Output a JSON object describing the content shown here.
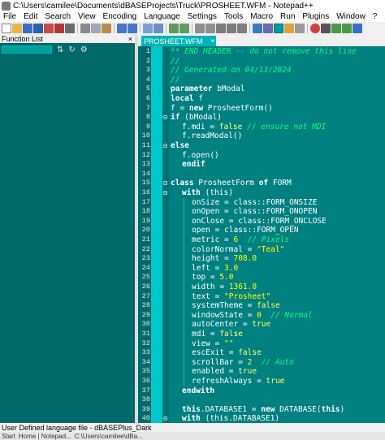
{
  "window": {
    "title": "C:\\Users\\camilee\\Documents\\dBASEProjects\\Truck\\PROSHEET.WFM - Notepad++"
  },
  "menubar": {
    "items": [
      "File",
      "Edit",
      "Search",
      "View",
      "Encoding",
      "Language",
      "Settings",
      "Tools",
      "Macro",
      "Run",
      "Plugins",
      "Window",
      "?"
    ],
    "close_label": "X"
  },
  "function_list": {
    "title": "Function List",
    "close_label": "×",
    "search_value": ""
  },
  "tab": {
    "label": "PROSHEET.WFM",
    "close_label": "×"
  },
  "editor": {
    "lines": [
      {
        "n": "1",
        "fold": "",
        "x": 40,
        "segs": [
          [
            "** END HEADER -- do not remove this line",
            "c-comment"
          ]
        ]
      },
      {
        "n": "2",
        "fold": "",
        "x": 40,
        "segs": [
          [
            "//",
            "c-comment"
          ]
        ]
      },
      {
        "n": "3",
        "fold": "",
        "x": 40,
        "segs": [
          [
            "// Generated on 04/13/2024",
            "c-comment"
          ]
        ]
      },
      {
        "n": "4",
        "fold": "",
        "x": 40,
        "segs": [
          [
            "//",
            "c-comment"
          ]
        ]
      },
      {
        "n": "5",
        "fold": "",
        "x": 40,
        "segs": [
          [
            "parameter",
            "c-kw"
          ],
          [
            " bModal",
            "c-ident"
          ]
        ]
      },
      {
        "n": "6",
        "fold": "",
        "x": 40,
        "segs": [
          [
            "local",
            "c-kw"
          ],
          [
            " f",
            "c-ident"
          ]
        ]
      },
      {
        "n": "7",
        "fold": "",
        "x": 40,
        "segs": [
          [
            "f = ",
            "c-ident"
          ],
          [
            "new",
            "c-kw"
          ],
          [
            " ProsheetForm()",
            "c-ident"
          ]
        ]
      },
      {
        "n": "8",
        "fold": "⊟",
        "x": 40,
        "segs": [
          [
            "if",
            "c-kw"
          ],
          [
            " (bModal)",
            "c-ident"
          ]
        ]
      },
      {
        "n": "9",
        "fold": "",
        "x": 54,
        "segs": [
          [
            "f.mdi = ",
            "c-ident"
          ],
          [
            "false",
            "c-const"
          ],
          [
            " // ensure not MDI",
            "c-comment"
          ]
        ]
      },
      {
        "n": "10",
        "fold": "",
        "x": 54,
        "segs": [
          [
            "f.readModal()",
            "c-ident"
          ]
        ]
      },
      {
        "n": "11",
        "fold": "⊟",
        "x": 40,
        "segs": [
          [
            "else",
            "c-kw"
          ]
        ]
      },
      {
        "n": "12",
        "fold": "",
        "x": 54,
        "segs": [
          [
            "f.open()",
            "c-ident"
          ]
        ]
      },
      {
        "n": "13",
        "fold": "",
        "x": 54,
        "segs": [
          [
            "endif",
            "c-kw"
          ]
        ]
      },
      {
        "n": "14",
        "fold": "",
        "x": 40,
        "segs": []
      },
      {
        "n": "15",
        "fold": "⊟",
        "x": 40,
        "segs": [
          [
            "class",
            "c-kw"
          ],
          [
            " ProsheetForm ",
            "c-ident"
          ],
          [
            "of",
            "c-kw"
          ],
          [
            " FORM",
            "c-ident"
          ]
        ]
      },
      {
        "n": "16",
        "fold": "⊟",
        "x": 54,
        "segs": [
          [
            "with",
            "c-kw"
          ],
          [
            " (this)",
            "c-ident"
          ]
        ]
      },
      {
        "n": "17",
        "fold": "",
        "x": 66,
        "segs": [
          [
            "onSize = class::FORM_ONSIZE",
            "c-ident"
          ]
        ]
      },
      {
        "n": "18",
        "fold": "",
        "x": 66,
        "segs": [
          [
            "onOpen = class::FORM_ONOPEN",
            "c-ident"
          ]
        ]
      },
      {
        "n": "19",
        "fold": "",
        "x": 66,
        "segs": [
          [
            "onClose = class::FORM_ONCLOSE",
            "c-ident"
          ]
        ]
      },
      {
        "n": "20",
        "fold": "",
        "x": 66,
        "segs": [
          [
            "open = class::FORM_OPEN",
            "c-ident"
          ]
        ]
      },
      {
        "n": "21",
        "fold": "",
        "x": 66,
        "segs": [
          [
            "metric = ",
            "c-ident"
          ],
          [
            "6",
            "c-num"
          ],
          [
            "  // Pixels",
            "c-comment"
          ]
        ]
      },
      {
        "n": "22",
        "fold": "",
        "x": 66,
        "segs": [
          [
            "colorNormal = ",
            "c-ident"
          ],
          [
            "\"Teal\"",
            "c-str"
          ]
        ]
      },
      {
        "n": "23",
        "fold": "",
        "x": 66,
        "segs": [
          [
            "height = ",
            "c-ident"
          ],
          [
            "708.0",
            "c-num"
          ]
        ]
      },
      {
        "n": "24",
        "fold": "",
        "x": 66,
        "segs": [
          [
            "left = ",
            "c-ident"
          ],
          [
            "3.0",
            "c-num"
          ]
        ]
      },
      {
        "n": "25",
        "fold": "",
        "x": 66,
        "segs": [
          [
            "top = ",
            "c-ident"
          ],
          [
            "5.0",
            "c-num"
          ]
        ]
      },
      {
        "n": "26",
        "fold": "",
        "x": 66,
        "segs": [
          [
            "width = ",
            "c-ident"
          ],
          [
            "1361.0",
            "c-num"
          ]
        ]
      },
      {
        "n": "27",
        "fold": "",
        "x": 66,
        "segs": [
          [
            "text = ",
            "c-ident"
          ],
          [
            "\"Prosheet\"",
            "c-str"
          ]
        ]
      },
      {
        "n": "28",
        "fold": "",
        "x": 66,
        "segs": [
          [
            "systemTheme = ",
            "c-ident"
          ],
          [
            "false",
            "c-const"
          ]
        ]
      },
      {
        "n": "29",
        "fold": "",
        "x": 66,
        "segs": [
          [
            "windowState = ",
            "c-ident"
          ],
          [
            "0",
            "c-num"
          ],
          [
            "  // Normal",
            "c-comment"
          ]
        ]
      },
      {
        "n": "30",
        "fold": "",
        "x": 66,
        "segs": [
          [
            "autoCenter = ",
            "c-ident"
          ],
          [
            "true",
            "c-const"
          ]
        ]
      },
      {
        "n": "31",
        "fold": "",
        "x": 66,
        "segs": [
          [
            "mdi = ",
            "c-ident"
          ],
          [
            "false",
            "c-const"
          ]
        ]
      },
      {
        "n": "32",
        "fold": "",
        "x": 66,
        "segs": [
          [
            "view = ",
            "c-ident"
          ],
          [
            "\"\"",
            "c-str"
          ]
        ]
      },
      {
        "n": "33",
        "fold": "",
        "x": 66,
        "segs": [
          [
            "escExit = ",
            "c-ident"
          ],
          [
            "false",
            "c-const"
          ]
        ]
      },
      {
        "n": "34",
        "fold": "",
        "x": 66,
        "segs": [
          [
            "scrollBar = ",
            "c-ident"
          ],
          [
            "2",
            "c-num"
          ],
          [
            "  // Auto",
            "c-comment"
          ]
        ]
      },
      {
        "n": "35",
        "fold": "",
        "x": 66,
        "segs": [
          [
            "enabled = ",
            "c-ident"
          ],
          [
            "true",
            "c-const"
          ]
        ]
      },
      {
        "n": "36",
        "fold": "",
        "x": 66,
        "segs": [
          [
            "refreshAlways = ",
            "c-ident"
          ],
          [
            "true",
            "c-const"
          ]
        ]
      },
      {
        "n": "37",
        "fold": "",
        "x": 54,
        "segs": [
          [
            "endwith",
            "c-kw"
          ]
        ]
      },
      {
        "n": "38",
        "fold": "",
        "x": 40,
        "segs": []
      },
      {
        "n": "39",
        "fold": "",
        "x": 54,
        "segs": [
          [
            "this",
            "c-kw"
          ],
          [
            ".DATABASE1 = ",
            "c-ident"
          ],
          [
            "new",
            "c-kw"
          ],
          [
            " DATABASE(",
            "c-ident"
          ],
          [
            "this",
            "c-kw"
          ],
          [
            ")",
            "c-ident"
          ]
        ]
      },
      {
        "n": "40",
        "fold": "⊟",
        "x": 54,
        "segs": [
          [
            "with",
            "c-kw"
          ],
          [
            " (this.DATABASE1)",
            "c-ident"
          ]
        ]
      }
    ]
  },
  "status": {
    "text": "User Defined language file - dBASEPlus_Dark"
  },
  "taskbar": {
    "items": [
      "Start",
      "Home | Notepad...",
      "C:\\Users\\camilee\\dBa..."
    ]
  }
}
